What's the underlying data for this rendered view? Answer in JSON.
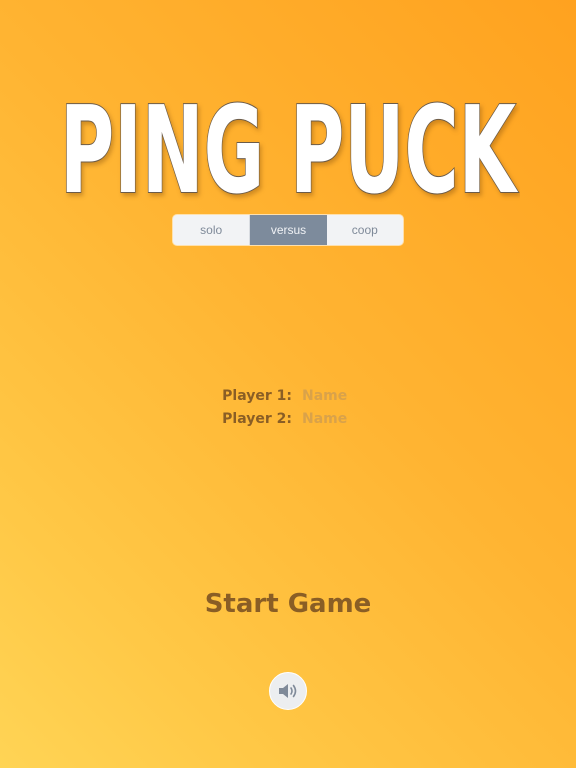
{
  "title": {
    "text": "PING PUCK"
  },
  "mode_control": {
    "options": [
      {
        "label": "solo",
        "selected": false
      },
      {
        "label": "versus",
        "selected": true
      },
      {
        "label": "coop",
        "selected": false
      }
    ]
  },
  "players": [
    {
      "label": "Player 1:",
      "placeholder": "Name",
      "value": ""
    },
    {
      "label": "Player 2:",
      "placeholder": "Name",
      "value": ""
    }
  ],
  "start_button": {
    "label": "Start Game"
  },
  "sound_button": {
    "icon": "speaker-icon"
  },
  "colors": {
    "text_brown": "#8a5e25",
    "placeholder": "#d9a24a",
    "segment_selected": "#7d8b9c",
    "segment_bg": "#f2f3f5"
  }
}
